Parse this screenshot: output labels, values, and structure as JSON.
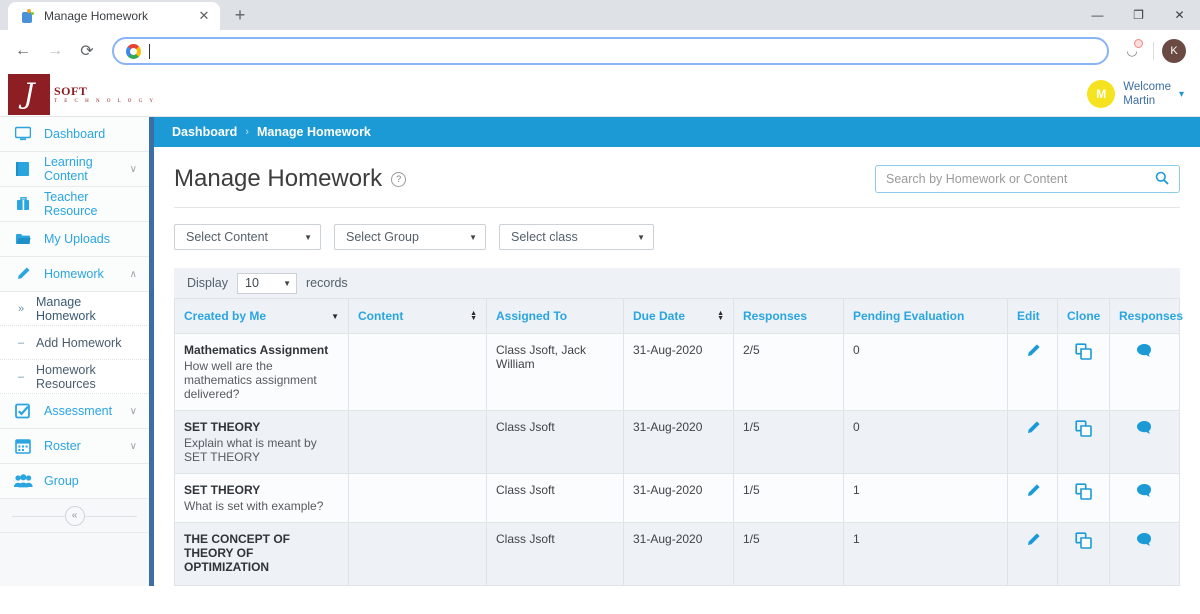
{
  "browser": {
    "tab": {
      "title": "Manage Homework",
      "favicon": "app-favicon",
      "close": "✕"
    },
    "newtab": "+",
    "window_controls": {
      "minimize": "—",
      "maximize": "❐",
      "close": "✕"
    },
    "nav": {
      "back": "←",
      "forward": "→",
      "reload": "⟳"
    },
    "omnibox": {
      "value": "",
      "placeholder": "",
      "search_engine_icon": "google-icon"
    },
    "extension_icon": "extension-icon",
    "profile_initial": "K"
  },
  "app_header": {
    "logo": {
      "mark": "J",
      "name": "SOFT",
      "tagline": "T E C H N O L O G Y"
    },
    "user": {
      "avatar_initial": "M",
      "greeting": "Welcome",
      "name": "Martin",
      "caret": "▾"
    }
  },
  "sidebar": {
    "items": [
      {
        "label": "Dashboard",
        "icon": "monitor-icon",
        "glyph": "▣",
        "chevron": ""
      },
      {
        "label": "Learning Content",
        "icon": "book-icon",
        "glyph": "◫",
        "chevron": "∨"
      },
      {
        "label": "Teacher Resource",
        "icon": "briefcase-icon",
        "glyph": "▮",
        "chevron": ""
      },
      {
        "label": "My Uploads",
        "icon": "folder-icon",
        "glyph": "▰",
        "chevron": ""
      },
      {
        "label": "Homework",
        "icon": "pencil-icon",
        "glyph": "✎",
        "chevron": "∧"
      }
    ],
    "sub_items": [
      {
        "label": "Manage Homework",
        "marker": "»",
        "active": true
      },
      {
        "label": "Add Homework",
        "marker": "–",
        "active": false
      },
      {
        "label": "Homework Resources",
        "marker": "–",
        "active": false
      }
    ],
    "items_after": [
      {
        "label": "Assessment",
        "icon": "checkbox-icon",
        "glyph": "☑",
        "chevron": "∨"
      },
      {
        "label": "Roster",
        "icon": "calendar-icon",
        "glyph": "▦",
        "chevron": "∨"
      },
      {
        "label": "Group",
        "icon": "people-icon",
        "glyph": "●",
        "chevron": ""
      }
    ],
    "collapse": "«"
  },
  "breadcrumb": {
    "root": "Dashboard",
    "separator": "›",
    "current": "Manage Homework"
  },
  "page": {
    "title": "Manage Homework",
    "help_icon_glyph": "?",
    "search": {
      "value": "",
      "placeholder": "Search by Homework or Content",
      "icon": "search-icon"
    }
  },
  "filters": [
    {
      "label": "Select Content",
      "name": "select-content"
    },
    {
      "label": "Select Group",
      "name": "select-group"
    },
    {
      "label": "Select class",
      "name": "select-class"
    }
  ],
  "display_bar": {
    "prefix": "Display",
    "value": "10",
    "suffix": "records"
  },
  "table": {
    "columns": [
      {
        "label": "Created by Me",
        "sort": "desc"
      },
      {
        "label": "Content",
        "sort": "both"
      },
      {
        "label": "Assigned To",
        "sort": "none"
      },
      {
        "label": "Due Date",
        "sort": "both"
      },
      {
        "label": "Responses",
        "sort": "none"
      },
      {
        "label": "Pending Evaluation",
        "sort": "none"
      },
      {
        "label": "Edit",
        "sort": "none"
      },
      {
        "label": "Clone",
        "sort": "none"
      },
      {
        "label": "Responses",
        "sort": "none"
      }
    ],
    "rows": [
      {
        "title": "Mathematics Assignment",
        "description": "How well are the mathematics assignment delivered?",
        "content": "",
        "assigned_to": "Class Jsoft, Jack William",
        "due_date": "31-Aug-2020",
        "responses": "2/5",
        "pending_evaluation": "0",
        "edit_icon": "pencil-icon",
        "clone_icon": "copy-icon",
        "responses_icon": "comment-icon"
      },
      {
        "title": "SET THEORY",
        "description": "Explain what is meant by SET THEORY",
        "content": "",
        "assigned_to": "Class Jsoft",
        "due_date": "31-Aug-2020",
        "responses": "1/5",
        "pending_evaluation": "0",
        "edit_icon": "pencil-icon",
        "clone_icon": "copy-icon",
        "responses_icon": "comment-icon"
      },
      {
        "title": "SET THEORY",
        "description": "What is set with example?",
        "content": "",
        "assigned_to": "Class Jsoft",
        "due_date": "31-Aug-2020",
        "responses": "1/5",
        "pending_evaluation": "1",
        "edit_icon": "pencil-icon",
        "clone_icon": "copy-icon",
        "responses_icon": "comment-icon"
      },
      {
        "title": "THE CONCEPT OF THEORY OF OPTIMIZATION",
        "description": "",
        "content": "",
        "assigned_to": "Class Jsoft",
        "due_date": "31-Aug-2020",
        "responses": "1/5",
        "pending_evaluation": "1",
        "edit_icon": "pencil-icon",
        "clone_icon": "copy-icon",
        "responses_icon": "comment-icon"
      }
    ]
  },
  "colors": {
    "brand_blue": "#1b9ad6",
    "accent_blue": "#2aa5e0",
    "logo_red": "#8d1f24",
    "sidebar_edge": "#3a6ea5",
    "header_row": "#eef2f6"
  }
}
